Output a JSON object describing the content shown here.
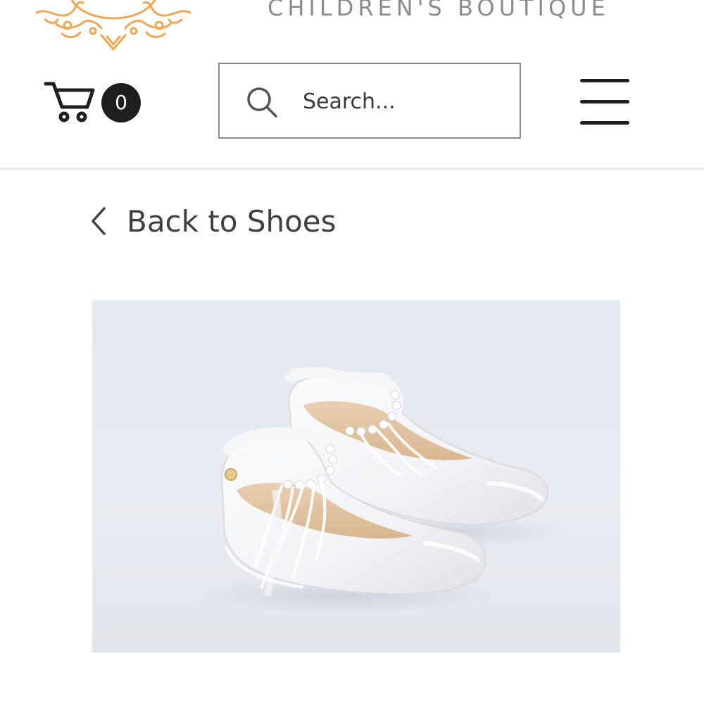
{
  "brand": {
    "name": "CHILDREN'S BOUTIQUE",
    "logo_icon": "ornamental-crest-logo",
    "logo_color": "#f0a552"
  },
  "header": {
    "cart_icon": "shopping-cart-icon",
    "cart_count": "0",
    "search_icon": "search-icon",
    "search_placeholder": "Search...",
    "menu_icon": "hamburger-menu-icon"
  },
  "navigation": {
    "back_icon": "chevron-left-icon",
    "back_label": "Back to Shoes"
  },
  "product": {
    "image_icon": "white-patent-shoes-with-pearl-and-feather-ankle-straps"
  },
  "colors": {
    "text_dark": "#1f1f1f",
    "text_muted": "#8c8c8c",
    "border": "#8a8a8a",
    "divider": "#ececec",
    "image_background": "#e6e9ef"
  }
}
